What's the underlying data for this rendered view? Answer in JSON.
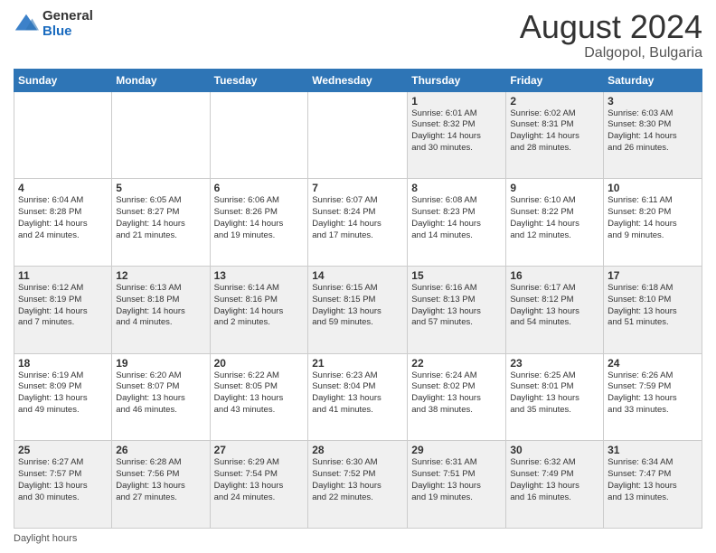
{
  "header": {
    "logo_general": "General",
    "logo_blue": "Blue",
    "title": "August 2024",
    "location": "Dalgopol, Bulgaria"
  },
  "calendar": {
    "days_of_week": [
      "Sunday",
      "Monday",
      "Tuesday",
      "Wednesday",
      "Thursday",
      "Friday",
      "Saturday"
    ],
    "weeks": [
      [
        {
          "day": "",
          "info": ""
        },
        {
          "day": "",
          "info": ""
        },
        {
          "day": "",
          "info": ""
        },
        {
          "day": "",
          "info": ""
        },
        {
          "day": "1",
          "info": "Sunrise: 6:01 AM\nSunset: 8:32 PM\nDaylight: 14 hours\nand 30 minutes."
        },
        {
          "day": "2",
          "info": "Sunrise: 6:02 AM\nSunset: 8:31 PM\nDaylight: 14 hours\nand 28 minutes."
        },
        {
          "day": "3",
          "info": "Sunrise: 6:03 AM\nSunset: 8:30 PM\nDaylight: 14 hours\nand 26 minutes."
        }
      ],
      [
        {
          "day": "4",
          "info": "Sunrise: 6:04 AM\nSunset: 8:28 PM\nDaylight: 14 hours\nand 24 minutes."
        },
        {
          "day": "5",
          "info": "Sunrise: 6:05 AM\nSunset: 8:27 PM\nDaylight: 14 hours\nand 21 minutes."
        },
        {
          "day": "6",
          "info": "Sunrise: 6:06 AM\nSunset: 8:26 PM\nDaylight: 14 hours\nand 19 minutes."
        },
        {
          "day": "7",
          "info": "Sunrise: 6:07 AM\nSunset: 8:24 PM\nDaylight: 14 hours\nand 17 minutes."
        },
        {
          "day": "8",
          "info": "Sunrise: 6:08 AM\nSunset: 8:23 PM\nDaylight: 14 hours\nand 14 minutes."
        },
        {
          "day": "9",
          "info": "Sunrise: 6:10 AM\nSunset: 8:22 PM\nDaylight: 14 hours\nand 12 minutes."
        },
        {
          "day": "10",
          "info": "Sunrise: 6:11 AM\nSunset: 8:20 PM\nDaylight: 14 hours\nand 9 minutes."
        }
      ],
      [
        {
          "day": "11",
          "info": "Sunrise: 6:12 AM\nSunset: 8:19 PM\nDaylight: 14 hours\nand 7 minutes."
        },
        {
          "day": "12",
          "info": "Sunrise: 6:13 AM\nSunset: 8:18 PM\nDaylight: 14 hours\nand 4 minutes."
        },
        {
          "day": "13",
          "info": "Sunrise: 6:14 AM\nSunset: 8:16 PM\nDaylight: 14 hours\nand 2 minutes."
        },
        {
          "day": "14",
          "info": "Sunrise: 6:15 AM\nSunset: 8:15 PM\nDaylight: 13 hours\nand 59 minutes."
        },
        {
          "day": "15",
          "info": "Sunrise: 6:16 AM\nSunset: 8:13 PM\nDaylight: 13 hours\nand 57 minutes."
        },
        {
          "day": "16",
          "info": "Sunrise: 6:17 AM\nSunset: 8:12 PM\nDaylight: 13 hours\nand 54 minutes."
        },
        {
          "day": "17",
          "info": "Sunrise: 6:18 AM\nSunset: 8:10 PM\nDaylight: 13 hours\nand 51 minutes."
        }
      ],
      [
        {
          "day": "18",
          "info": "Sunrise: 6:19 AM\nSunset: 8:09 PM\nDaylight: 13 hours\nand 49 minutes."
        },
        {
          "day": "19",
          "info": "Sunrise: 6:20 AM\nSunset: 8:07 PM\nDaylight: 13 hours\nand 46 minutes."
        },
        {
          "day": "20",
          "info": "Sunrise: 6:22 AM\nSunset: 8:05 PM\nDaylight: 13 hours\nand 43 minutes."
        },
        {
          "day": "21",
          "info": "Sunrise: 6:23 AM\nSunset: 8:04 PM\nDaylight: 13 hours\nand 41 minutes."
        },
        {
          "day": "22",
          "info": "Sunrise: 6:24 AM\nSunset: 8:02 PM\nDaylight: 13 hours\nand 38 minutes."
        },
        {
          "day": "23",
          "info": "Sunrise: 6:25 AM\nSunset: 8:01 PM\nDaylight: 13 hours\nand 35 minutes."
        },
        {
          "day": "24",
          "info": "Sunrise: 6:26 AM\nSunset: 7:59 PM\nDaylight: 13 hours\nand 33 minutes."
        }
      ],
      [
        {
          "day": "25",
          "info": "Sunrise: 6:27 AM\nSunset: 7:57 PM\nDaylight: 13 hours\nand 30 minutes."
        },
        {
          "day": "26",
          "info": "Sunrise: 6:28 AM\nSunset: 7:56 PM\nDaylight: 13 hours\nand 27 minutes."
        },
        {
          "day": "27",
          "info": "Sunrise: 6:29 AM\nSunset: 7:54 PM\nDaylight: 13 hours\nand 24 minutes."
        },
        {
          "day": "28",
          "info": "Sunrise: 6:30 AM\nSunset: 7:52 PM\nDaylight: 13 hours\nand 22 minutes."
        },
        {
          "day": "29",
          "info": "Sunrise: 6:31 AM\nSunset: 7:51 PM\nDaylight: 13 hours\nand 19 minutes."
        },
        {
          "day": "30",
          "info": "Sunrise: 6:32 AM\nSunset: 7:49 PM\nDaylight: 13 hours\nand 16 minutes."
        },
        {
          "day": "31",
          "info": "Sunrise: 6:34 AM\nSunset: 7:47 PM\nDaylight: 13 hours\nand 13 minutes."
        }
      ]
    ]
  },
  "footer": {
    "text": "Daylight hours"
  }
}
